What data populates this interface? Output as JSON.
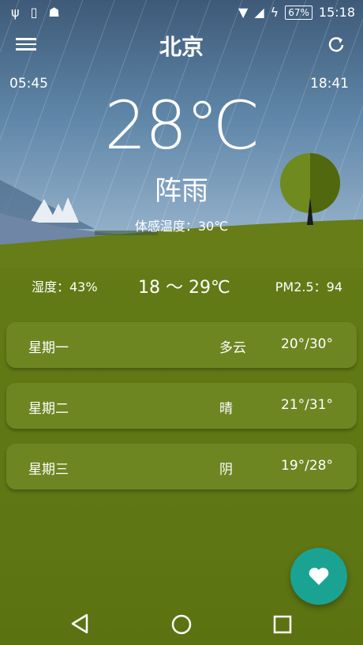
{
  "status_bar": {
    "icons_left": [
      "usb-icon",
      "clipboard-icon",
      "android-icon"
    ],
    "battery": "67%",
    "time": "15:18"
  },
  "toolbar": {
    "city": "北京"
  },
  "sun": {
    "sunrise": "05:45",
    "sunset": "18:41"
  },
  "current": {
    "temperature": "28℃",
    "condition": "阵雨",
    "feels_like": "体感温度：30℃"
  },
  "stats": {
    "humidity": "湿度：43%",
    "range": "18 ～ 29℃",
    "pm25": "PM2.5：94"
  },
  "forecast": [
    {
      "day": "星期一",
      "condition": "多云",
      "range": "20°/30°"
    },
    {
      "day": "星期二",
      "condition": "晴",
      "range": "21°/31°"
    },
    {
      "day": "星期三",
      "condition": "阴",
      "range": "19°/28°"
    }
  ],
  "colors": {
    "sky": "#5f86a8",
    "grass": "#5f7814",
    "fab": "#1aa393"
  }
}
